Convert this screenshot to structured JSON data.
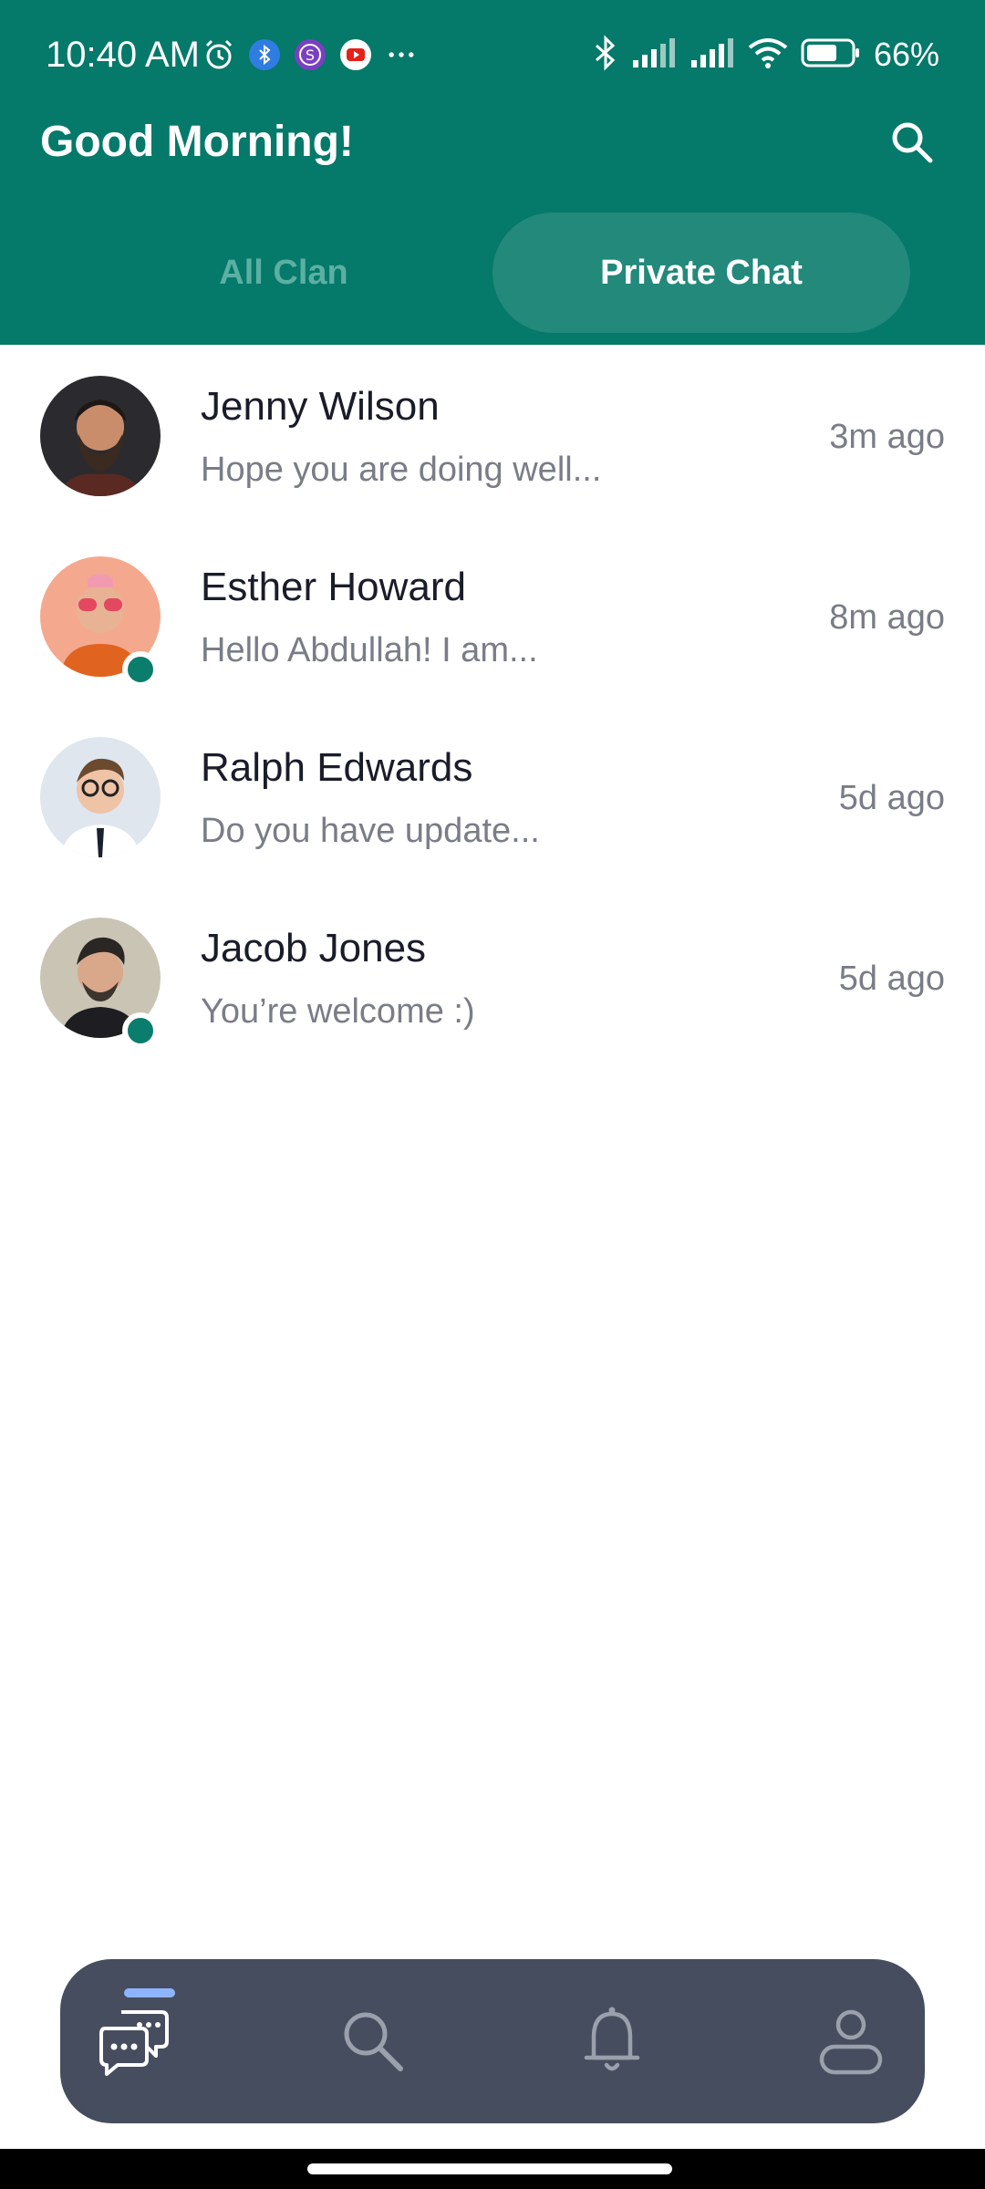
{
  "status_bar": {
    "time": "10:40 AM",
    "battery": "66%"
  },
  "header": {
    "greeting": "Good Morning!"
  },
  "tabs": [
    {
      "label": "All Clan",
      "active": false
    },
    {
      "label": "Private Chat",
      "active": true
    }
  ],
  "chats": [
    {
      "name": "Jenny Wilson",
      "preview": "Hope you are doing well...",
      "time": "3m ago",
      "online": false
    },
    {
      "name": "Esther Howard",
      "preview": "Hello Abdullah! I am...",
      "time": "8m ago",
      "online": true
    },
    {
      "name": "Ralph Edwards",
      "preview": "Do you have update...",
      "time": "5d ago",
      "online": false
    },
    {
      "name": "Jacob Jones",
      "preview": "You’re welcome :)",
      "time": "5d ago",
      "online": true
    }
  ],
  "nav": {
    "items": [
      "chat-icon",
      "search-icon",
      "bell-icon",
      "profile-icon"
    ],
    "active_index": 0
  },
  "colors": {
    "header_bg": "#05796a",
    "tab_active_bg": "#22897b",
    "online": "#0a7d6d",
    "nav_bg": "#464d5e",
    "nav_indicator": "#8fb4ff"
  }
}
